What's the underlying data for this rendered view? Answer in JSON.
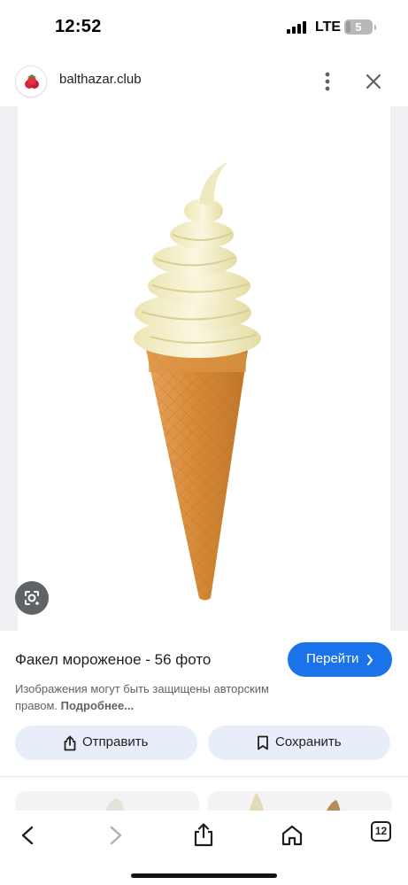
{
  "status_bar": {
    "time": "12:52",
    "network": "LTE",
    "battery": "5"
  },
  "header": {
    "site": "balthazar.club",
    "favicon_icon": "raspberry-icon",
    "more_icon": "more-vertical-icon",
    "close_icon": "close-icon"
  },
  "image": {
    "subject": "soft-serve-ice-cream-cone",
    "lens_icon": "google-lens-icon"
  },
  "info": {
    "title": "Факел мороженое - 56 фото",
    "visit_label": "Перейти",
    "copyright_text": "Изображения могут быть защищены авторским правом.",
    "learn_more": "Подробнее..."
  },
  "actions": {
    "share_label": "Отправить",
    "save_label": "Сохранить"
  },
  "toolbar": {
    "tabs_count": "12"
  },
  "colors": {
    "accent": "#1a73e8",
    "action_bg": "#e8eef9",
    "cone": "#d9903f",
    "cream": "#f4f0c8"
  }
}
